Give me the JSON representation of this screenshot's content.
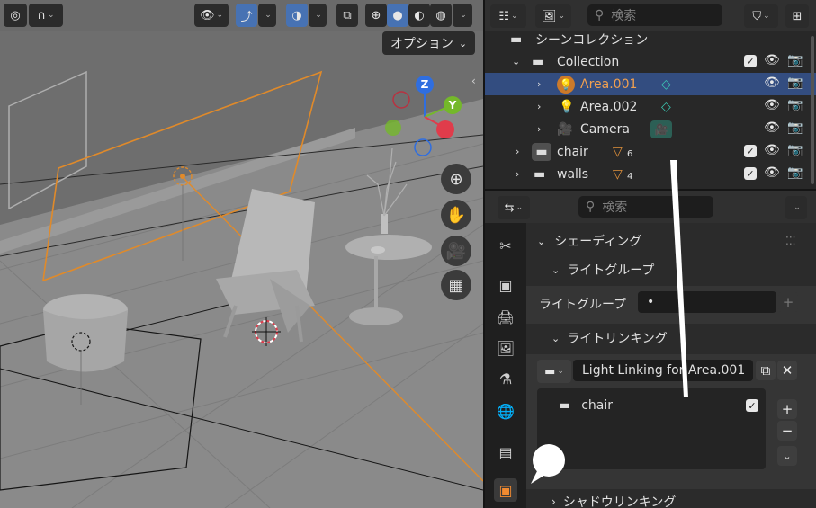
{
  "viewport": {
    "options_label": "オプション",
    "gizmo": {
      "z_label": "Z",
      "y_label": "Y"
    }
  },
  "outliner": {
    "search_placeholder": "検索",
    "scene_collection_label": "シーンコレクション",
    "rows": [
      {
        "label": "Collection"
      },
      {
        "label": "Area.001"
      },
      {
        "label": "Area.002"
      },
      {
        "label": "Camera"
      },
      {
        "label": "chair",
        "badge": "6"
      },
      {
        "label": "walls",
        "badge": "4"
      }
    ]
  },
  "properties": {
    "search_placeholder": "検索",
    "shading_label": "シェーディング",
    "light_group_header": "ライトグループ",
    "light_group_field_label": "ライトグループ",
    "light_group_value": "•",
    "light_linking_header": "ライトリンキング",
    "light_linking_collection": "Light Linking for Area.001",
    "linked_items": [
      {
        "label": "chair"
      }
    ],
    "shadow_linking_header": "シャドウリンキング"
  },
  "colors": {
    "accent_blue": "#4772b3",
    "selection_row": "#334d80",
    "selected_text": "#f0a050",
    "light_orange": "#e08a2a",
    "axis_z": "#2f6ee0",
    "axis_y": "#74b82a",
    "axis_x": "#e03c4b"
  }
}
